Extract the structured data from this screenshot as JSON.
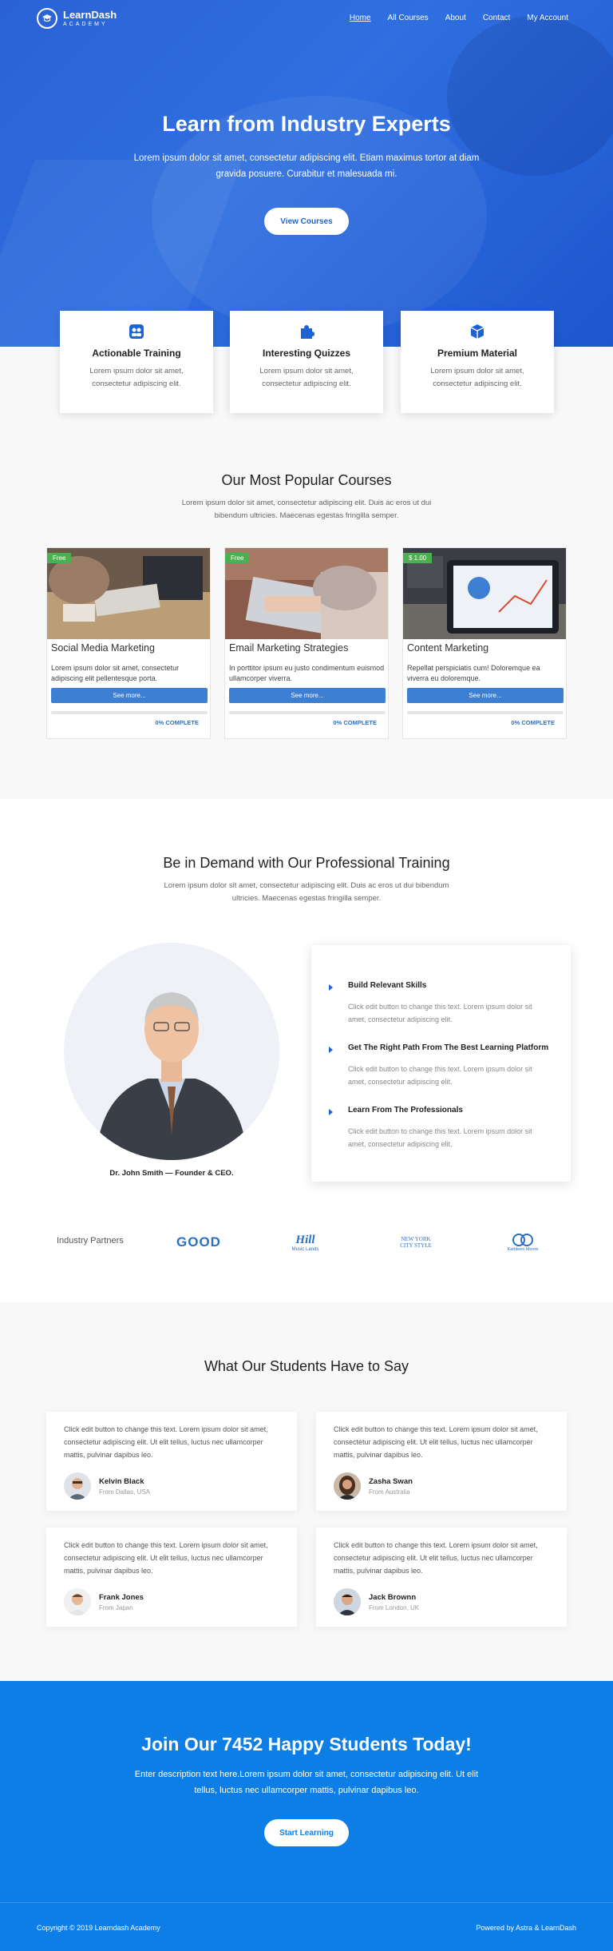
{
  "nav": {
    "logo_title": "LearnDash",
    "logo_subtitle": "ACADEMY",
    "items": [
      "Home",
      "All Courses",
      "About",
      "Contact",
      "My Account"
    ]
  },
  "hero": {
    "title": "Learn from Industry Experts",
    "subtitle": "Lorem ipsum dolor sit amet, consectetur adipiscing elit. Etiam maximus tortor at diam gravida posuere. Curabitur et malesuada mi.",
    "button": "View Courses"
  },
  "features": [
    {
      "title": "Actionable Training",
      "text": "Lorem ipsum dolor sit amet, consectetur adipiscing elit.",
      "icon": "users-icon"
    },
    {
      "title": "Interesting Quizzes",
      "text": "Lorem ipsum dolor sit amet, consectetur adipiscing elit.",
      "icon": "puzzle-icon"
    },
    {
      "title": "Premium Material",
      "text": "Lorem ipsum dolor sit amet, consectetur adipiscing elit.",
      "icon": "cube-icon"
    }
  ],
  "popular": {
    "title": "Our Most Popular Courses",
    "subtitle": "Lorem ipsum dolor sit amet, consectetur adipiscing elit. Duis ac eros ut dui bibendum ultricies. Maecenas egestas fringilla semper.",
    "courses": [
      {
        "badge": "Free",
        "title": "Social Media Marketing",
        "desc": "Lorem ipsum dolor sit amet, consectetur adipiscing elit pellentesque porta.",
        "button": "See more...",
        "progress": "0% COMPLETE"
      },
      {
        "badge": "Free",
        "title": "Email Marketing Strategies",
        "desc": "In porttitor ipsum eu justo condimentum euismod ullamcorper viverra.",
        "button": "See more...",
        "progress": "0% COMPLETE"
      },
      {
        "badge": "$ 1.00",
        "title": "Content Marketing",
        "desc": "Repellat perspiciatis cum! Doloremque ea viverra eu doloremque.",
        "button": "See more...",
        "progress": "0% COMPLETE"
      }
    ]
  },
  "training": {
    "title": "Be in Demand with Our Professional Training",
    "subtitle": "Lorem ipsum dolor sit amet, consectetur adipiscing elit. Duis ac eros ut dui bibendum ultricies. Maecenas egestas fringilla semper.",
    "caption": "Dr. John Smith — Founder & CEO.",
    "items": [
      {
        "title": "Build Relevant Skills",
        "text": "Click edit button to change this text. Lorem ipsum dolor sit amet, consectetur adipiscing elit."
      },
      {
        "title": "Get The Right Path From The Best Learning Platform",
        "text": "Click edit button to change this text. Lorem ipsum dolor sit amet, consectetur adipiscing elit."
      },
      {
        "title": "Learn From The Professionals",
        "text": "Click edit button to change this text. Lorem ipsum dolor sit amet, consectetur adipiscing elit."
      }
    ]
  },
  "partners": {
    "label": "Industry Partners",
    "logos": [
      {
        "name": "GOOD"
      },
      {
        "name": "Hill",
        "sub": "Music Lands"
      },
      {
        "name": "NEW YORK",
        "sub": "CITY STYLE"
      },
      {
        "name": "Kathleen Moore"
      }
    ]
  },
  "testimonials": {
    "title": "What Our Students Have to Say",
    "items": [
      {
        "text": "Click edit button to change this text. Lorem ipsum dolor sit amet, consectetur adipiscing elit. Ut elit tellus, luctus nec ullamcorper mattis, pulvinar dapibus leo.",
        "name": "Kelvin Black",
        "from": "From Dallas, USA"
      },
      {
        "text": "Click edit button to change this text. Lorem ipsum dolor sit amet, consectetur adipiscing elit. Ut elit tellus, luctus nec ullamcorper mattis, pulvinar dapibus leo.",
        "name": "Zasha Swan",
        "from": "From Australia"
      },
      {
        "text": "Click edit button to change this text. Lorem ipsum dolor sit amet, consectetur adipiscing elit. Ut elit tellus, luctus nec ullamcorper mattis, pulvinar dapibus leo.",
        "name": "Frank Jones",
        "from": "From Japan"
      },
      {
        "text": "Click edit button to change this text. Lorem ipsum dolor sit amet, consectetur adipiscing elit. Ut elit tellus, luctus nec ullamcorper mattis, pulvinar dapibus leo.",
        "name": "Jack Brownn",
        "from": "From London, UK"
      }
    ]
  },
  "cta": {
    "title": "Join Our 7452 Happy Students Today!",
    "text": "Enter description text here.Lorem ipsum dolor sit amet, consectetur adipiscing elit. Ut elit tellus, luctus nec ullamcorper mattis, pulvinar dapibus leo.",
    "button": "Start Learning"
  },
  "footer": {
    "copyright": "Copyright © 2019 Learndash Academy",
    "powered": "Powered by Astra & LearnDash"
  },
  "colors": {
    "brand_blue": "#1e63d4",
    "cta_blue": "#0c7ee6",
    "badge_green": "#4caf50",
    "button_blue": "#3d7fd2"
  }
}
